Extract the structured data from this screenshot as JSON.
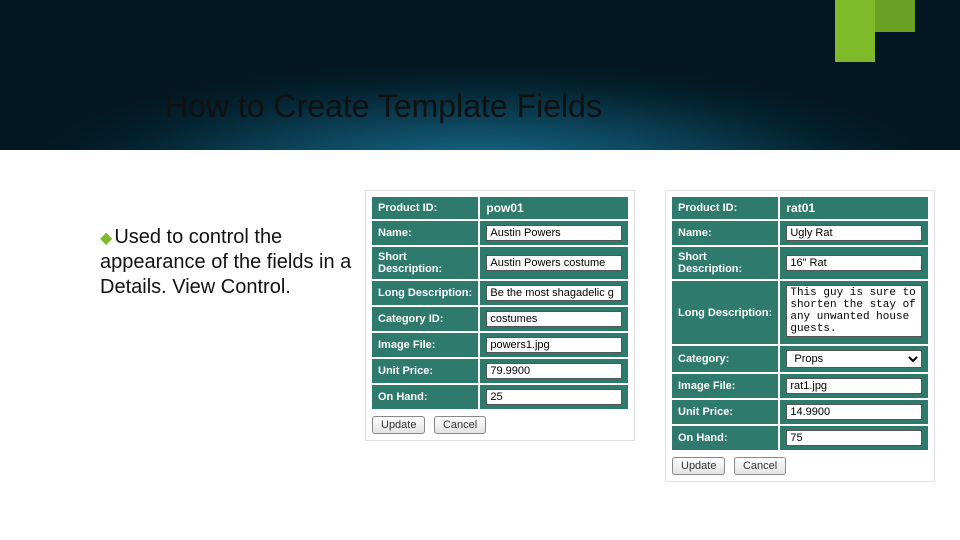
{
  "title": "How to Create Template Fields",
  "bullet": {
    "text": "Used to control the appearance of the fields in a Details. View Control."
  },
  "panelLeft": {
    "rows": {
      "productId": {
        "label": "Product ID:",
        "value": "pow01"
      },
      "name": {
        "label": "Name:",
        "value": "Austin Powers"
      },
      "shortDesc": {
        "label": "Short Description:",
        "value": "Austin Powers costume"
      },
      "longDesc": {
        "label": "Long Description:",
        "value": "Be the most shagadelic g"
      },
      "categoryId": {
        "label": "Category ID:",
        "value": "costumes"
      },
      "imageFile": {
        "label": "Image File:",
        "value": "powers1.jpg"
      },
      "unitPrice": {
        "label": "Unit Price:",
        "value": "79.9900"
      },
      "onHand": {
        "label": "On Hand:",
        "value": "25"
      }
    },
    "buttons": {
      "update": "Update",
      "cancel": "Cancel"
    }
  },
  "panelRight": {
    "rows": {
      "productId": {
        "label": "Product ID:",
        "value": "rat01"
      },
      "name": {
        "label": "Name:",
        "value": "Ugly Rat"
      },
      "shortDesc": {
        "label": "Short Description:",
        "value": "16\" Rat"
      },
      "longDesc": {
        "label": "Long Description:",
        "value": "This guy is sure to shorten the stay of any unwanted house guests."
      },
      "category": {
        "label": "Category:",
        "value": "Props"
      },
      "imageFile": {
        "label": "Image File:",
        "value": "rat1.jpg"
      },
      "unitPrice": {
        "label": "Unit Price:",
        "value": "14.9900"
      },
      "onHand": {
        "label": "On Hand:",
        "value": "75"
      }
    },
    "buttons": {
      "update": "Update",
      "cancel": "Cancel"
    }
  }
}
